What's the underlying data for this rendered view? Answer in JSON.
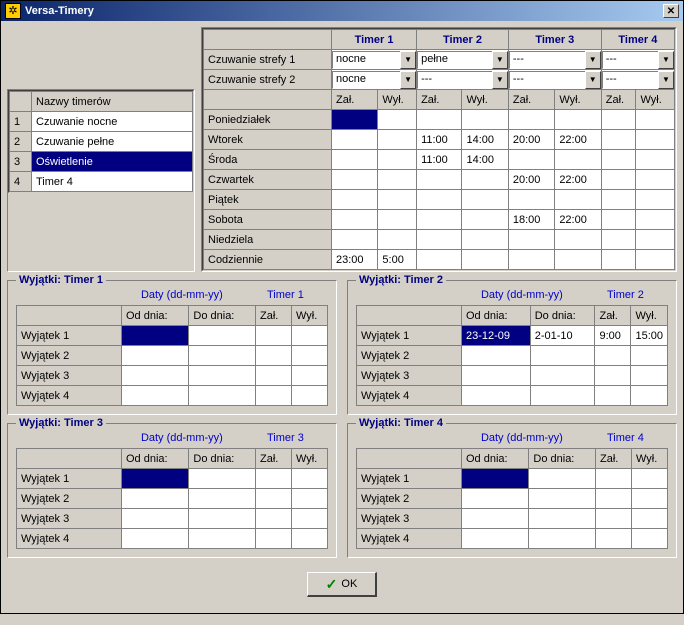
{
  "window_title": "Versa-Timery",
  "names_header": "Nazwy timerów",
  "timer_names": [
    "Czuwanie nocne",
    "Czuwanie pełne",
    "Oświetlenie",
    "Timer 4"
  ],
  "selected_name_index": 2,
  "timer_headers": [
    "Timer 1",
    "Timer 2",
    "Timer 3",
    "Timer 4"
  ],
  "zone_labels": [
    "Czuwanie strefy 1",
    "Czuwanie strefy 2"
  ],
  "zone1_vals": [
    "nocne",
    "pełne",
    "---",
    "---"
  ],
  "zone2_vals": [
    "nocne",
    "---",
    "---",
    "---"
  ],
  "zal": "Zał.",
  "wyl": "Wył.",
  "days": [
    "Poniedziałek",
    "Wtorek",
    "Środa",
    "Czwartek",
    "Piątek",
    "Sobota",
    "Niedziela",
    "Codziennie"
  ],
  "sched": {
    "Wtorek": [
      "",
      "",
      "11:00",
      "14:00",
      "20:00",
      "22:00",
      "",
      ""
    ],
    "Środa": [
      "",
      "",
      "11:00",
      "14:00",
      "",
      "",
      "",
      ""
    ],
    "Czwartek": [
      "",
      "",
      "",
      "",
      "20:00",
      "22:00",
      "",
      ""
    ],
    "Sobota": [
      "",
      "",
      "",
      "",
      "18:00",
      "22:00",
      "",
      ""
    ],
    "Codziennie": [
      "23:00",
      "5:00",
      "",
      "",
      "",
      "",
      "",
      ""
    ]
  },
  "exc_labels": {
    "daty": "Daty (dd-mm-yy)",
    "timer": "Timer",
    "od": "Od dnia:",
    "do": "Do dnia:",
    "rows": [
      "Wyjątek 1",
      "Wyjątek 2",
      "Wyjątek 3",
      "Wyjątek 4"
    ]
  },
  "exc_titles": [
    "Wyjątki: Timer 1",
    "Wyjątki: Timer 2",
    "Wyjątki: Timer 3",
    "Wyjątki: Timer 4"
  ],
  "exc2_row1": {
    "od": "23-12-09",
    "do": "2-01-10",
    "zal": "9:00",
    "wyl": "15:00"
  },
  "ok_label": "OK"
}
